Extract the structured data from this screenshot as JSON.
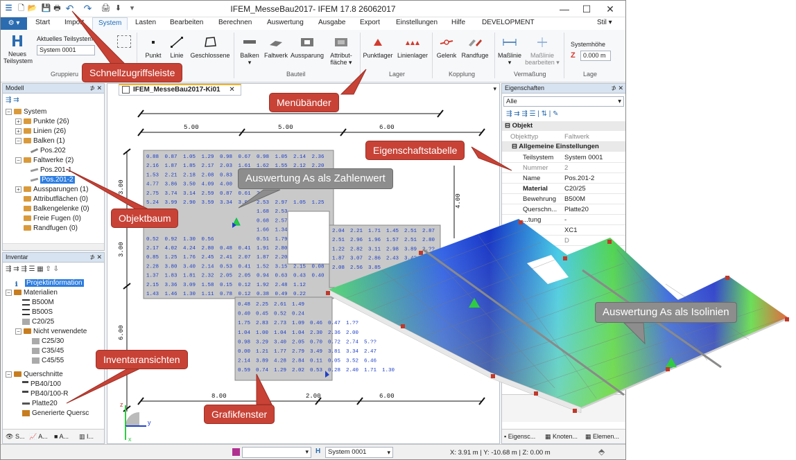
{
  "window": {
    "title": "IFEM_MesseBau2017- IFEM 17.8 26062017",
    "minimize": "—",
    "maximize": "☐",
    "close": "✕",
    "stil": "Stil ▾"
  },
  "menu": {
    "tabs": [
      "Start",
      "Import",
      "System",
      "Lasten",
      "Bearbeiten",
      "Berechnen",
      "Auswertung",
      "Ausgabe",
      "Export",
      "Einstellungen",
      "Hilfe",
      "DEVELOPMENT"
    ],
    "active": "System"
  },
  "ribbon": {
    "neues_teilsystem": "Neues Teilsystem",
    "aktuelles_label": "Aktuelles Teilsystem",
    "aktuelles_value": "System 0001",
    "gruppe_label": "Gruppieru",
    "punkt": "Punkt",
    "linie": "Linie",
    "geschlossene": "Geschlossene",
    "geschlossene2": "Linie",
    "balken": "Balken",
    "faltwerk": "Faltwerk",
    "aussparung": "Aussparung",
    "attribut": "Attribut-",
    "attribut2": "fläche",
    "bauteil": "Bauteil",
    "punktlager": "Punktlager",
    "linienlager": "Linienlager",
    "lager": "Lager",
    "gelenk": "Gelenk",
    "randfuge": "Randfuge",
    "kopplung": "Kopplung",
    "masslinie": "Maßlinie",
    "masslinie_bearb": "Maßlinie",
    "masslinie_bearb2": "bearbeiten",
    "vermassung": "Vermaßung",
    "systemhoehe": "Systemhöhe",
    "systemhoehe_value": "0.000 m",
    "lage": "Lage"
  },
  "model_panel": {
    "title": "Modell",
    "items": [
      {
        "label": "System"
      },
      {
        "label": "Punkte (26)"
      },
      {
        "label": "Linien (26)"
      },
      {
        "label": "Balken (1)"
      },
      {
        "label": "Pos.202"
      },
      {
        "label": "Faltwerke (2)"
      },
      {
        "label": "Pos.201-1"
      },
      {
        "label": "Pos.201-2"
      },
      {
        "label": "Aussparungen (1)"
      },
      {
        "label": "Attributflächen (0)"
      },
      {
        "label": "Balkengelenke (0)"
      },
      {
        "label": "Freie Fugen (0)"
      },
      {
        "label": "Randfugen (0)"
      }
    ]
  },
  "inventar_panel": {
    "title": "Inventar",
    "items": [
      {
        "label": "Projektinformation"
      },
      {
        "label": "Materialien"
      },
      {
        "label": "B500M"
      },
      {
        "label": "B500S"
      },
      {
        "label": "C20/25"
      },
      {
        "label": "Nicht verwendete"
      },
      {
        "label": "C25/30"
      },
      {
        "label": "C35/45"
      },
      {
        "label": "C45/55"
      },
      {
        "label": "Querschnitte"
      },
      {
        "label": "PB40/100"
      },
      {
        "label": "PB40/100-R"
      },
      {
        "label": "Platte20"
      },
      {
        "label": "Generierte Quersc"
      }
    ],
    "bottom_tabs": [
      "S...",
      "A...",
      "A...",
      "I..."
    ]
  },
  "document": {
    "tab": "IFEM_MesseBau2017-Ki01",
    "dims_top": [
      "5.00",
      "5.00",
      "6.00"
    ],
    "dims_left": [
      "3.00",
      "3.00",
      "6.00"
    ],
    "dims_right": [
      "4.00"
    ],
    "dims_bottom": [
      "8.00",
      "2.00",
      "6.00"
    ],
    "axis_z": "z",
    "axis_y": "y",
    "axis_x": "x",
    "grid_rows": [
      [
        "0.88",
        "0.87",
        "1.05",
        "1.29",
        "0.98",
        "0.67",
        "0.98",
        "1.05",
        "2.14",
        "2.36"
      ],
      [
        "2.16",
        "1.87",
        "1.85",
        "2.17",
        "2.03",
        "1.61",
        "1.62",
        "1.55",
        "2.12",
        "2.20"
      ],
      [
        "1.53",
        "2.21",
        "2.18",
        "2.08",
        "0.83",
        "",
        "",
        "",
        "",
        ""
      ],
      [
        "4.77",
        "3.86",
        "3.50",
        "4.09",
        "4.00",
        "",
        "",
        "",
        "",
        ""
      ],
      [
        "2.75",
        "3.74",
        "3.14",
        "2.59",
        "0.87",
        "0.61",
        "2.71",
        "",
        "",
        ""
      ],
      [
        "5.24",
        "3.99",
        "2.90",
        "3.59",
        "3.34",
        "3.07",
        "2.53",
        "2.97",
        "1.05",
        "1.25"
      ],
      [
        "",
        "",
        "",
        "",
        "",
        "",
        "1.68",
        "2.53",
        "",
        ""
      ],
      [
        "",
        "",
        "",
        "",
        "",
        "",
        "0.68",
        "2.57",
        "",
        ""
      ],
      [
        "",
        "",
        "",
        "",
        "",
        "",
        "1.66",
        "1.34",
        "",
        ""
      ],
      [
        "0.52",
        "0.92",
        "1.30",
        "0.56",
        "",
        "",
        "0.51",
        "1.79",
        "",
        ""
      ],
      [
        "2.17",
        "4.02",
        "4.24",
        "2.80",
        "0.48",
        "0.41",
        "1.91",
        "2.80",
        "",
        ""
      ],
      [
        "0.85",
        "1.25",
        "1.76",
        "2.45",
        "2.41",
        "2.07",
        "1.87",
        "2.20",
        "",
        ""
      ],
      [
        "2.28",
        "3.80",
        "3.40",
        "2.14",
        "0.53",
        "0.41",
        "1.52",
        "3.15",
        "2.15",
        "0.08"
      ],
      [
        "1.37",
        "1.83",
        "1.81",
        "2.32",
        "2.05",
        "2.05",
        "0.94",
        "0.63",
        "0.43",
        "0.40"
      ],
      [
        "2.15",
        "3.36",
        "3.09",
        "1.58",
        "0.15",
        "0.12",
        "1.92",
        "2.48",
        "1.12",
        ""
      ],
      [
        "1.43",
        "1.46",
        "1.30",
        "1.11",
        "0.78",
        "0.12",
        "0.38",
        "0.49",
        "0.22",
        ""
      ]
    ],
    "grid_rows_right": [
      [
        "2.04",
        "2.21",
        "1.71",
        "1.45",
        "2.51",
        "2.87"
      ],
      [
        "2.51",
        "2.96",
        "1.96",
        "1.57",
        "2.51",
        "2.80"
      ],
      [
        "1.22",
        "2.82",
        "3.11",
        "2.98",
        "3.89",
        "2.??"
      ],
      [
        "1.87",
        "3.07",
        "2.86",
        "2.43",
        "3.4?",
        ""
      ],
      [
        "2.08",
        "2.56",
        "3.85",
        "",
        "",
        ""
      ]
    ],
    "grid_rows_lower": [
      [
        "0.48",
        "2.25",
        "2.61",
        "1.49"
      ],
      [
        "0.40",
        "0.45",
        "0.52",
        "0.24"
      ],
      [
        "1.75",
        "2.83",
        "2.73",
        "1.09",
        "0.46",
        "0.47",
        "1.??"
      ],
      [
        "1.04",
        "1.00",
        "1.04",
        "1.04",
        "2.30",
        "2.36",
        "2.00"
      ],
      [
        "0.98",
        "3.29",
        "3.40",
        "2.05",
        "0.70",
        "0.72",
        "2.74",
        "5.??"
      ],
      [
        "0.00",
        "1.21",
        "1.77",
        "2.79",
        "3.49",
        "3.81",
        "3.34",
        "2.47"
      ],
      [
        "2.14",
        "3.89",
        "4.28",
        "2.84",
        "0.11",
        "0.05",
        "3.52",
        "6.46"
      ],
      [
        "0.59",
        "0.74",
        "1.29",
        "2.02",
        "0.53",
        "0.28",
        "2.40",
        "1.71",
        "1.30"
      ]
    ]
  },
  "properties": {
    "title": "Eigenschaften",
    "filter": "Alle",
    "category": "Objekt",
    "objekttyp_k": "Objekttyp",
    "objekttyp_v": "Faltwerk",
    "subcategory": "Allgemeine Einstellungen",
    "rows": [
      {
        "k": "Teilsystem",
        "v": "System 0001"
      },
      {
        "k": "Nummer",
        "v": "2"
      },
      {
        "k": "Name",
        "v": "Pos.201-2"
      },
      {
        "k": "Material",
        "v": "C20/25"
      },
      {
        "k": "Bewehrung",
        "v": "B500M"
      },
      {
        "k": "Querschn...",
        "v": "Platte20"
      },
      {
        "k": "...tung",
        "v": "-"
      },
      {
        "k": "...e",
        "v": "XC1"
      },
      {
        "k": "",
        "v": "D"
      }
    ],
    "bottom_tabs": [
      "Eigensc...",
      "Knoten...",
      "Elemen..."
    ]
  },
  "status": {
    "system": "System 0001",
    "coords": "X: 3.91 m | Y: -10.68 m | Z: 0.00 m"
  },
  "callouts": {
    "schnellzugriff": "Schnellzugriffsleiste",
    "menubaender": "Menübänder",
    "eigenschaftstabelle": "Eigenschaftstabelle",
    "objektbaum": "Objektbaum",
    "inventaransichten": "Inventaransichten",
    "grafikfenster": "Grafikfenster",
    "zahlenwert": "Auswertung As als Zahlenwert",
    "isolinien": "Auswertung As als Isolinien"
  },
  "colors": {
    "callout_red": "#c84236",
    "callout_grey": "#8d8d8d",
    "accent_blue": "#2b6cb0",
    "contour_blue": "#1f3fd4",
    "contour_green": "#3fcf4a",
    "contour_red": "#e0442a"
  }
}
